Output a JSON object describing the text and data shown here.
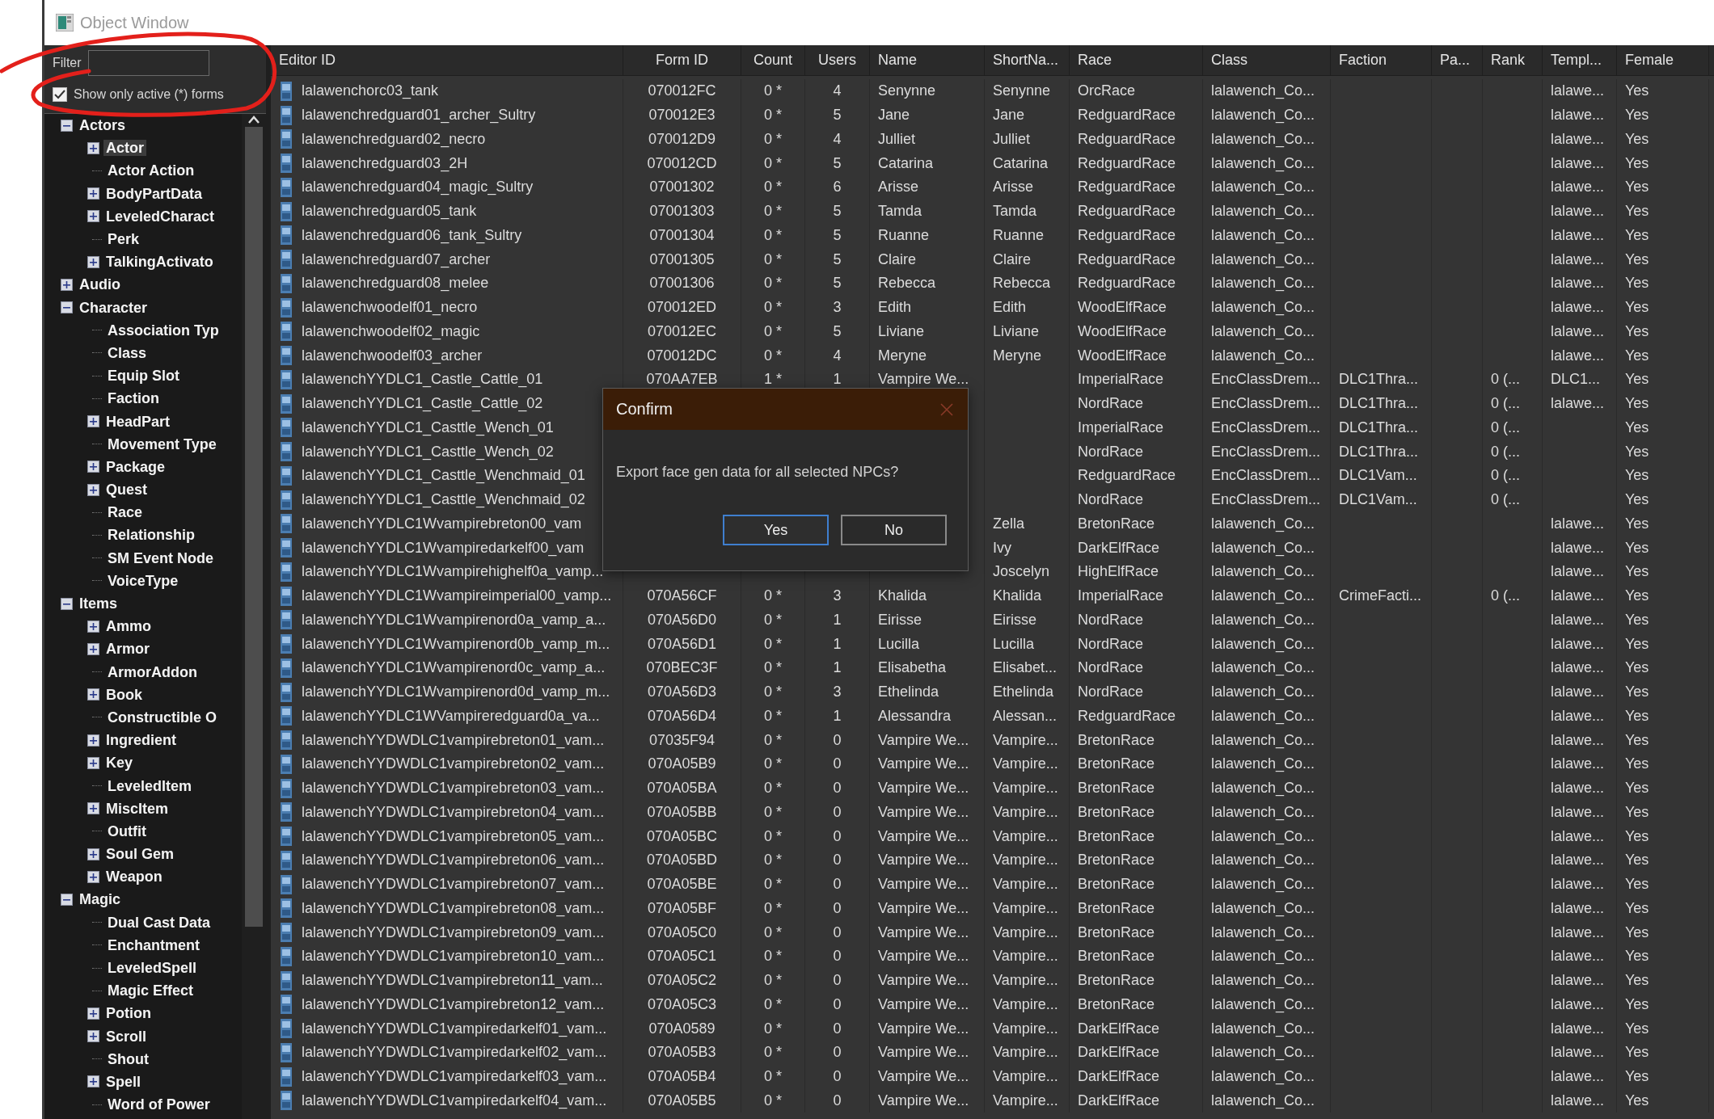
{
  "window": {
    "title": "Object Window"
  },
  "filter": {
    "label": "Filter"
  },
  "active_only": {
    "label": "Show only active (*) forms",
    "checked": true
  },
  "tree": [
    {
      "label": "Actors",
      "expanded": true,
      "selected": false,
      "children": [
        {
          "label": "Actor",
          "expanded": false,
          "selected": true
        },
        {
          "label": "Actor Action",
          "selected": false
        },
        {
          "label": "BodyPartData",
          "expanded": false,
          "selected": false
        },
        {
          "label": "LeveledCharact",
          "expanded": false,
          "selected": false
        },
        {
          "label": "Perk",
          "selected": false
        },
        {
          "label": "TalkingActivato",
          "expanded": false,
          "selected": false
        }
      ]
    },
    {
      "label": "Audio",
      "expanded": false,
      "selected": false
    },
    {
      "label": "Character",
      "expanded": true,
      "selected": false,
      "children": [
        {
          "label": "Association Typ",
          "selected": false
        },
        {
          "label": "Class",
          "selected": false
        },
        {
          "label": "Equip Slot",
          "selected": false
        },
        {
          "label": "Faction",
          "selected": false
        },
        {
          "label": "HeadPart",
          "expanded": false,
          "selected": false
        },
        {
          "label": "Movement Type",
          "selected": false
        },
        {
          "label": "Package",
          "expanded": false,
          "selected": false
        },
        {
          "label": "Quest",
          "expanded": false,
          "selected": false
        },
        {
          "label": "Race",
          "selected": false
        },
        {
          "label": "Relationship",
          "selected": false
        },
        {
          "label": "SM Event Node",
          "selected": false
        },
        {
          "label": "VoiceType",
          "selected": false
        }
      ]
    },
    {
      "label": "Items",
      "expanded": true,
      "selected": false,
      "children": [
        {
          "label": "Ammo",
          "expanded": false,
          "selected": false
        },
        {
          "label": "Armor",
          "expanded": false,
          "selected": false
        },
        {
          "label": "ArmorAddon",
          "selected": false
        },
        {
          "label": "Book",
          "expanded": false,
          "selected": false
        },
        {
          "label": "Constructible O",
          "selected": false
        },
        {
          "label": "Ingredient",
          "expanded": false,
          "selected": false
        },
        {
          "label": "Key",
          "expanded": false,
          "selected": false
        },
        {
          "label": "LeveledItem",
          "selected": false
        },
        {
          "label": "MiscItem",
          "expanded": false,
          "selected": false
        },
        {
          "label": "Outfit",
          "selected": false
        },
        {
          "label": "Soul Gem",
          "expanded": false,
          "selected": false
        },
        {
          "label": "Weapon",
          "expanded": false,
          "selected": false
        }
      ]
    },
    {
      "label": "Magic",
      "expanded": true,
      "selected": false,
      "children": [
        {
          "label": "Dual Cast Data",
          "selected": false
        },
        {
          "label": "Enchantment",
          "selected": false
        },
        {
          "label": "LeveledSpell",
          "selected": false
        },
        {
          "label": "Magic Effect",
          "selected": false
        },
        {
          "label": "Potion",
          "expanded": false,
          "selected": false
        },
        {
          "label": "Scroll",
          "expanded": false,
          "selected": false
        },
        {
          "label": "Shout",
          "selected": false
        },
        {
          "label": "Spell",
          "expanded": false,
          "selected": false
        },
        {
          "label": "Word of Power",
          "selected": false
        }
      ]
    }
  ],
  "table": {
    "columns": [
      "Editor ID",
      "Form ID",
      "Count",
      "Users",
      "Name",
      "ShortNa...",
      "Race",
      "Class",
      "Faction",
      "Pa...",
      "Rank",
      "Templ...",
      "Female"
    ],
    "rows": [
      [
        "lalawenchorc03_tank",
        "070012FC",
        "0 *",
        "4",
        "Senynne",
        "Senynne",
        "OrcRace",
        "lalawench_Co...",
        null,
        null,
        null,
        "lalawe...",
        "Yes"
      ],
      [
        "lalawenchredguard01_archer_Sultry",
        "070012E3",
        "0 *",
        "5",
        "Jane",
        "Jane",
        "RedguardRace",
        "lalawench_Co...",
        null,
        null,
        null,
        "lalawe...",
        "Yes"
      ],
      [
        "lalawenchredguard02_necro",
        "070012D9",
        "0 *",
        "4",
        "Julliet",
        "Julliet",
        "RedguardRace",
        "lalawench_Co...",
        null,
        null,
        null,
        "lalawe...",
        "Yes"
      ],
      [
        "lalawenchredguard03_2H",
        "070012CD",
        "0 *",
        "5",
        "Catarina",
        "Catarina",
        "RedguardRace",
        "lalawench_Co...",
        null,
        null,
        null,
        "lalawe...",
        "Yes"
      ],
      [
        "lalawenchredguard04_magic_Sultry",
        "07001302",
        "0 *",
        "6",
        "Arisse",
        "Arisse",
        "RedguardRace",
        "lalawench_Co...",
        null,
        null,
        null,
        "lalawe...",
        "Yes"
      ],
      [
        "lalawenchredguard05_tank",
        "07001303",
        "0 *",
        "5",
        "Tamda",
        "Tamda",
        "RedguardRace",
        "lalawench_Co...",
        null,
        null,
        null,
        "lalawe...",
        "Yes"
      ],
      [
        "lalawenchredguard06_tank_Sultry",
        "07001304",
        "0 *",
        "5",
        "Ruanne",
        "Ruanne",
        "RedguardRace",
        "lalawench_Co...",
        null,
        null,
        null,
        "lalawe...",
        "Yes"
      ],
      [
        "lalawenchredguard07_archer",
        "07001305",
        "0 *",
        "5",
        "Claire",
        "Claire",
        "RedguardRace",
        "lalawench_Co...",
        null,
        null,
        null,
        "lalawe...",
        "Yes"
      ],
      [
        "lalawenchredguard08_melee",
        "07001306",
        "0 *",
        "5",
        "Rebecca",
        "Rebecca",
        "RedguardRace",
        "lalawench_Co...",
        null,
        null,
        null,
        "lalawe...",
        "Yes"
      ],
      [
        "lalawenchwoodelf01_necro",
        "070012ED",
        "0 *",
        "3",
        "Edith",
        "Edith",
        "WoodElfRace",
        "lalawench_Co...",
        null,
        null,
        null,
        "lalawe...",
        "Yes"
      ],
      [
        "lalawenchwoodelf02_magic",
        "070012EC",
        "0 *",
        "5",
        "Liviane",
        "Liviane",
        "WoodElfRace",
        "lalawench_Co...",
        null,
        null,
        null,
        "lalawe...",
        "Yes"
      ],
      [
        "lalawenchwoodelf03_archer",
        "070012DC",
        "0 *",
        "4",
        "Meryne",
        "Meryne",
        "WoodElfRace",
        "lalawench_Co...",
        null,
        null,
        null,
        "lalawe...",
        "Yes"
      ],
      [
        "lalawenchYYDLC1_Castle_Cattle_01",
        "070AA7EB",
        "1 *",
        "1",
        "Vampire We...",
        null,
        "ImperialRace",
        "EncClassDrem...",
        "DLC1Thra...",
        null,
        "0 (...",
        "DLC1...",
        "Yes"
      ],
      [
        "lalawenchYYDLC1_Castle_Cattle_02",
        null,
        null,
        null,
        null,
        null,
        "NordRace",
        "EncClassDrem...",
        "DLC1Thra...",
        null,
        "0 (...",
        "lalawe...",
        "Yes"
      ],
      [
        "lalawenchYYDLC1_Casttle_Wench_01",
        null,
        null,
        null,
        null,
        null,
        "ImperialRace",
        "EncClassDrem...",
        "DLC1Thra...",
        null,
        "0 (...",
        null,
        "Yes"
      ],
      [
        "lalawenchYYDLC1_Casttle_Wench_02",
        null,
        null,
        null,
        null,
        null,
        "NordRace",
        "EncClassDrem...",
        "DLC1Thra...",
        null,
        "0 (...",
        null,
        "Yes"
      ],
      [
        "lalawenchYYDLC1_Casttle_Wenchmaid_01",
        null,
        null,
        null,
        null,
        null,
        "RedguardRace",
        "EncClassDrem...",
        "DLC1Vam...",
        null,
        "0 (...",
        null,
        "Yes"
      ],
      [
        "lalawenchYYDLC1_Casttle_Wenchmaid_02",
        null,
        null,
        null,
        null,
        null,
        "NordRace",
        "EncClassDrem...",
        "DLC1Vam...",
        null,
        "0 (...",
        null,
        "Yes"
      ],
      [
        "lalawenchYYDLC1Wvampirebreton00_vam",
        null,
        null,
        null,
        null,
        "Zella",
        "BretonRace",
        "lalawench_Co...",
        null,
        null,
        null,
        "lalawe...",
        "Yes"
      ],
      [
        "lalawenchYYDLC1Wvampiredarkelf00_vam",
        null,
        null,
        null,
        null,
        "Ivy",
        "DarkElfRace",
        "lalawench_Co...",
        null,
        null,
        null,
        "lalawe...",
        "Yes"
      ],
      [
        "lalawenchYYDLC1Wvampirehighelf0a_vamp...",
        null,
        null,
        null,
        null,
        "Joscelyn",
        "HighElfRace",
        "lalawench_Co...",
        null,
        null,
        null,
        "lalawe...",
        "Yes"
      ],
      [
        "lalawenchYYDLC1Wvampireimperial00_vamp...",
        "070A56CF",
        "0 *",
        "3",
        "Khalida",
        "Khalida",
        "ImperialRace",
        "lalawench_Co...",
        "CrimeFacti...",
        null,
        "0 (...",
        "lalawe...",
        "Yes"
      ],
      [
        "lalawenchYYDLC1Wvampirenord0a_vamp_a...",
        "070A56D0",
        "0 *",
        "1",
        "Eirisse",
        "Eirisse",
        "NordRace",
        "lalawench_Co...",
        null,
        null,
        null,
        "lalawe...",
        "Yes"
      ],
      [
        "lalawenchYYDLC1Wvampirenord0b_vamp_m...",
        "070A56D1",
        "0 *",
        "1",
        "Lucilla",
        "Lucilla",
        "NordRace",
        "lalawench_Co...",
        null,
        null,
        null,
        "lalawe...",
        "Yes"
      ],
      [
        "lalawenchYYDLC1Wvampirenord0c_vamp_a...",
        "070BEC3F",
        "0 *",
        "1",
        "Elisabetha",
        "Elisabet...",
        "NordRace",
        "lalawench_Co...",
        null,
        null,
        null,
        "lalawe...",
        "Yes"
      ],
      [
        "lalawenchYYDLC1Wvampirenord0d_vamp_m...",
        "070A56D3",
        "0 *",
        "3",
        "Ethelinda",
        "Ethelinda",
        "NordRace",
        "lalawench_Co...",
        null,
        null,
        null,
        "lalawe...",
        "Yes"
      ],
      [
        "lalawenchYYDLC1WVampireredguard0a_va...",
        "070A56D4",
        "0 *",
        "1",
        "Alessandra",
        "Alessan...",
        "RedguardRace",
        "lalawench_Co...",
        null,
        null,
        null,
        "lalawe...",
        "Yes"
      ],
      [
        "lalawenchYYDWDLC1vampirebreton01_vam...",
        "07035F94",
        "0 *",
        "0",
        "Vampire We...",
        "Vampire...",
        "BretonRace",
        "lalawench_Co...",
        null,
        null,
        null,
        "lalawe...",
        "Yes"
      ],
      [
        "lalawenchYYDWDLC1vampirebreton02_vam...",
        "070A05B9",
        "0 *",
        "0",
        "Vampire We...",
        "Vampire...",
        "BretonRace",
        "lalawench_Co...",
        null,
        null,
        null,
        "lalawe...",
        "Yes"
      ],
      [
        "lalawenchYYDWDLC1vampirebreton03_vam...",
        "070A05BA",
        "0 *",
        "0",
        "Vampire We...",
        "Vampire...",
        "BretonRace",
        "lalawench_Co...",
        null,
        null,
        null,
        "lalawe...",
        "Yes"
      ],
      [
        "lalawenchYYDWDLC1vampirebreton04_vam...",
        "070A05BB",
        "0 *",
        "0",
        "Vampire We...",
        "Vampire...",
        "BretonRace",
        "lalawench_Co...",
        null,
        null,
        null,
        "lalawe...",
        "Yes"
      ],
      [
        "lalawenchYYDWDLC1vampirebreton05_vam...",
        "070A05BC",
        "0 *",
        "0",
        "Vampire We...",
        "Vampire...",
        "BretonRace",
        "lalawench_Co...",
        null,
        null,
        null,
        "lalawe...",
        "Yes"
      ],
      [
        "lalawenchYYDWDLC1vampirebreton06_vam...",
        "070A05BD",
        "0 *",
        "0",
        "Vampire We...",
        "Vampire...",
        "BretonRace",
        "lalawench_Co...",
        null,
        null,
        null,
        "lalawe...",
        "Yes"
      ],
      [
        "lalawenchYYDWDLC1vampirebreton07_vam...",
        "070A05BE",
        "0 *",
        "0",
        "Vampire We...",
        "Vampire...",
        "BretonRace",
        "lalawench_Co...",
        null,
        null,
        null,
        "lalawe...",
        "Yes"
      ],
      [
        "lalawenchYYDWDLC1vampirebreton08_vam...",
        "070A05BF",
        "0 *",
        "0",
        "Vampire We...",
        "Vampire...",
        "BretonRace",
        "lalawench_Co...",
        null,
        null,
        null,
        "lalawe...",
        "Yes"
      ],
      [
        "lalawenchYYDWDLC1vampirebreton09_vam...",
        "070A05C0",
        "0 *",
        "0",
        "Vampire We...",
        "Vampire...",
        "BretonRace",
        "lalawench_Co...",
        null,
        null,
        null,
        "lalawe...",
        "Yes"
      ],
      [
        "lalawenchYYDWDLC1vampirebreton10_vam...",
        "070A05C1",
        "0 *",
        "0",
        "Vampire We...",
        "Vampire...",
        "BretonRace",
        "lalawench_Co...",
        null,
        null,
        null,
        "lalawe...",
        "Yes"
      ],
      [
        "lalawenchYYDWDLC1vampirebreton11_vam...",
        "070A05C2",
        "0 *",
        "0",
        "Vampire We...",
        "Vampire...",
        "BretonRace",
        "lalawench_Co...",
        null,
        null,
        null,
        "lalawe...",
        "Yes"
      ],
      [
        "lalawenchYYDWDLC1vampirebreton12_vam...",
        "070A05C3",
        "0 *",
        "0",
        "Vampire We...",
        "Vampire...",
        "BretonRace",
        "lalawench_Co...",
        null,
        null,
        null,
        "lalawe...",
        "Yes"
      ],
      [
        "lalawenchYYDWDLC1vampiredarkelf01_vam...",
        "070A0589",
        "0 *",
        "0",
        "Vampire We...",
        "Vampire...",
        "DarkElfRace",
        "lalawench_Co...",
        null,
        null,
        null,
        "lalawe...",
        "Yes"
      ],
      [
        "lalawenchYYDWDLC1vampiredarkelf02_vam...",
        "070A05B3",
        "0 *",
        "0",
        "Vampire We...",
        "Vampire...",
        "DarkElfRace",
        "lalawench_Co...",
        null,
        null,
        null,
        "lalawe...",
        "Yes"
      ],
      [
        "lalawenchYYDWDLC1vampiredarkelf03_vam...",
        "070A05B4",
        "0 *",
        "0",
        "Vampire We...",
        "Vampire...",
        "DarkElfRace",
        "lalawench_Co...",
        null,
        null,
        null,
        "lalawe...",
        "Yes"
      ],
      [
        "lalawenchYYDWDLC1vampiredarkelf04_vam...",
        "070A05B5",
        "0 *",
        "0",
        "Vampire We...",
        "Vampire...",
        "DarkElfRace",
        "lalawench_Co...",
        null,
        null,
        null,
        "lalawe...",
        "Yes"
      ]
    ]
  },
  "dialog": {
    "title": "Confirm",
    "message": "Export face gen data for all selected NPCs?",
    "buttons": [
      {
        "label": "Yes",
        "focused": true
      },
      {
        "label": "No",
        "focused": false
      }
    ]
  }
}
